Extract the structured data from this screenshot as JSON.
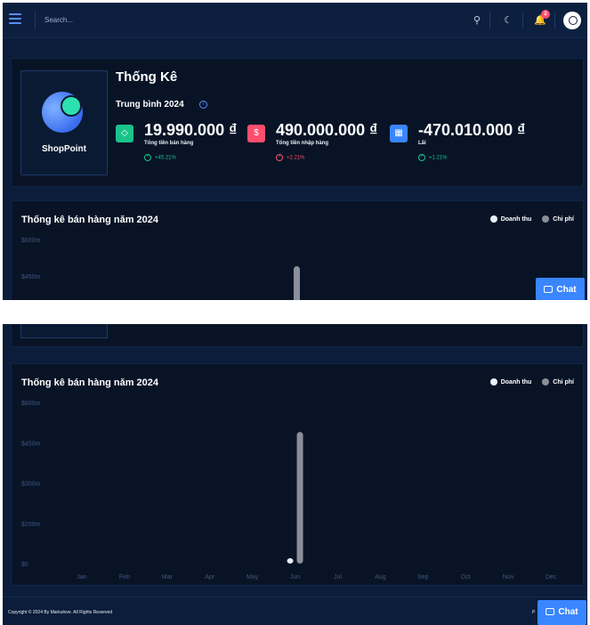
{
  "topbar": {
    "search_placeholder": "Search...",
    "notification_count": "2"
  },
  "stats": {
    "title": "Thống Kê",
    "brand": "ShopPoint",
    "subtitle": "Trung bình 2024",
    "metrics": [
      {
        "value": "19.990.000 ₫",
        "label": "Tổng tiền bán hàng",
        "change": "+45.21%",
        "color": "#19c38a",
        "icon": "diamond-icon"
      },
      {
        "value": "490.000.000 ₫",
        "label": "Tổng tiền nhập hàng",
        "change": "+2.21%",
        "color": "#ff4d6d",
        "icon": "dollar-icon"
      },
      {
        "value": "-470.010.000 ₫",
        "label": "Lãi",
        "change": "+1.21%",
        "color": "#3a86ff",
        "icon": "barcode-icon"
      }
    ]
  },
  "chat": {
    "label": "Chat"
  },
  "footer": {
    "copyright": "Copyright © 2024 By Markulove. All Rights Reserved",
    "right_text": "P"
  },
  "chart_data": {
    "type": "bar",
    "title": "Thống kê bán hàng năm 2024",
    "categories": [
      "Jan",
      "Feb",
      "Mar",
      "Apr",
      "May",
      "Jun",
      "Jul",
      "Aug",
      "Sep",
      "Oct",
      "Nov",
      "Dec"
    ],
    "series": [
      {
        "name": "Doanh thu",
        "color": "#e8f0ff",
        "values": [
          0,
          0,
          0,
          0,
          0,
          19.99,
          0,
          0,
          0,
          0,
          0,
          0
        ]
      },
      {
        "name": "Chi phí",
        "color": "#8a8f99",
        "values": [
          0,
          0,
          0,
          0,
          0,
          490,
          0,
          0,
          0,
          0,
          0,
          0
        ]
      }
    ],
    "yticks": [
      "$0",
      "$150m",
      "$300m",
      "$450m",
      "$600m"
    ],
    "ylim": [
      0,
      600
    ],
    "yunit": "m",
    "legend_position": "top-right",
    "grid": false
  }
}
